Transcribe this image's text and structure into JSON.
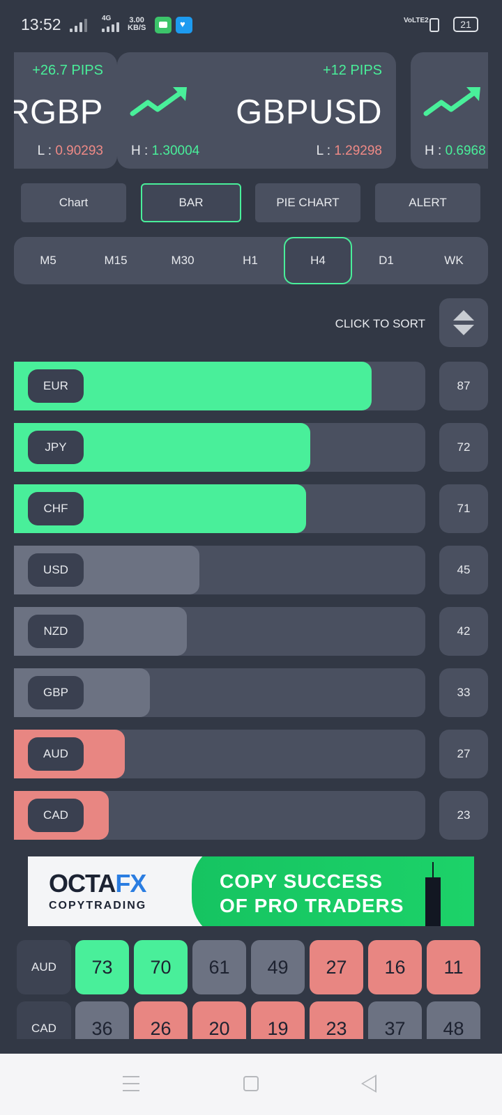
{
  "status_bar": {
    "time": "13:52",
    "network": "4G",
    "speed_value": "3.00",
    "speed_unit": "KB/S",
    "volte": "VoLTE2",
    "battery": "21"
  },
  "tickers": [
    {
      "pair": "RGBP",
      "pips": "+26.7 PIPS",
      "high_label": "H :",
      "high": "",
      "low_label": "L :",
      "low": "0.90293"
    },
    {
      "pair": "GBPUSD",
      "pips": "+12 PIPS",
      "high_label": "H :",
      "high": "1.30004",
      "low_label": "L :",
      "low": "1.29298"
    },
    {
      "pair": "",
      "pips": "",
      "high_label": "H :",
      "high": "0.6968",
      "low_label": "",
      "low": ""
    }
  ],
  "chart_tabs": [
    {
      "label": "Chart"
    },
    {
      "label": "BAR"
    },
    {
      "label": "PIE CHART"
    },
    {
      "label": "ALERT"
    }
  ],
  "active_chart_tab": "BAR",
  "timeframes": [
    "M5",
    "M15",
    "M30",
    "H1",
    "H4",
    "D1",
    "WK"
  ],
  "active_timeframe": "H4",
  "sort": {
    "label": "CLICK TO SORT"
  },
  "strength": [
    {
      "currency": "EUR",
      "value": 87,
      "status": "strong"
    },
    {
      "currency": "JPY",
      "value": 72,
      "status": "strong"
    },
    {
      "currency": "CHF",
      "value": 71,
      "status": "strong"
    },
    {
      "currency": "USD",
      "value": 45,
      "status": "neutral"
    },
    {
      "currency": "NZD",
      "value": 42,
      "status": "neutral"
    },
    {
      "currency": "GBP",
      "value": 33,
      "status": "neutral"
    },
    {
      "currency": "AUD",
      "value": 27,
      "status": "weak"
    },
    {
      "currency": "CAD",
      "value": 23,
      "status": "weak"
    }
  ],
  "ad": {
    "brand_main": "OCTA",
    "brand_accent": "FX",
    "brand_sub": "COPYTRADING",
    "tagline_1": "COPY SUCCESS",
    "tagline_2": "OF PRO TRADERS"
  },
  "matrix": [
    {
      "currency": "AUD",
      "values": [
        "73",
        "70",
        "61",
        "49",
        "27",
        "16",
        "11"
      ],
      "status": [
        "strong",
        "strong",
        "neutral",
        "neutral",
        "weak",
        "weak",
        "weak"
      ]
    },
    {
      "currency": "CAD",
      "values": [
        "36",
        "26",
        "20",
        "19",
        "23",
        "37",
        "48"
      ],
      "status": [
        "neutral",
        "weak",
        "weak",
        "weak",
        "weak",
        "neutral",
        "neutral"
      ]
    }
  ],
  "colors": {
    "background": "#323845",
    "panel": "#4a5060",
    "strong": "#49ef9a",
    "neutral": "#6c7282",
    "weak": "#e88682",
    "high_text": "#49ef9a",
    "low_text": "#ef8a86"
  },
  "icons": [
    "signal-icon",
    "message-app-icon",
    "twitter-app-icon",
    "vibrate-icon",
    "battery-icon",
    "trend-up-icon",
    "sort-icon",
    "menu-icon",
    "home-icon",
    "back-icon"
  ]
}
